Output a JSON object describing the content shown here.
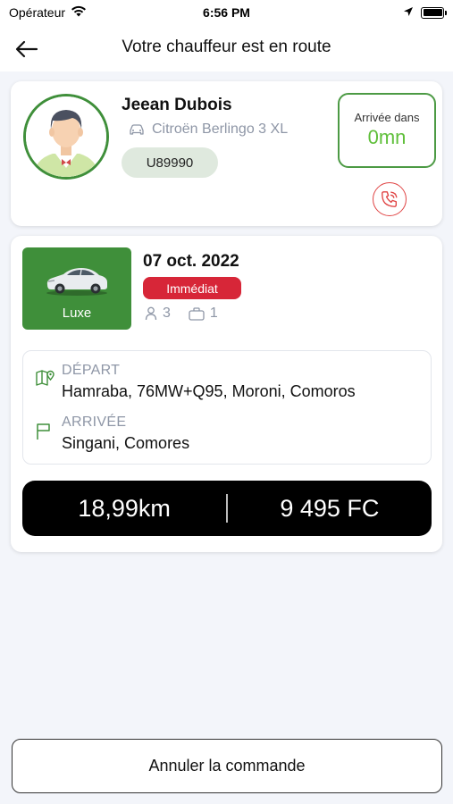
{
  "status_bar": {
    "carrier": "Opérateur",
    "time": "6:56 PM"
  },
  "header": {
    "title": "Votre chauffeur est en route"
  },
  "driver": {
    "name": "Jeean Dubois",
    "vehicle": "Citroën Berlingo 3 XL",
    "plate": "U89990",
    "eta_label": "Arrivée dans",
    "eta_value": "0mn"
  },
  "ride": {
    "category": "Luxe",
    "date": "07 oct. 2022",
    "badge": "Immédiat",
    "passengers": "3",
    "luggage": "1",
    "departure_label": "DÉPART",
    "departure_value": "Hamraba, 76MW+Q95, Moroni, Comoros",
    "arrival_label": "ARRIVÉE",
    "arrival_value": "Singani, Comores",
    "distance": "18,99km",
    "price": "9 495 FC"
  },
  "actions": {
    "cancel_label": "Annuler la commande"
  },
  "colors": {
    "brand_green": "#3f8f3a",
    "eta_green": "#5fbf3a",
    "badge_red": "#d72638",
    "call_red": "#e04545"
  },
  "icons": {
    "back": "arrow-left-icon",
    "vehicle": "car-icon",
    "call": "phone-call-icon",
    "passengers": "person-icon",
    "luggage": "briefcase-icon",
    "departure": "map-pin-icon",
    "arrival": "flag-icon"
  }
}
